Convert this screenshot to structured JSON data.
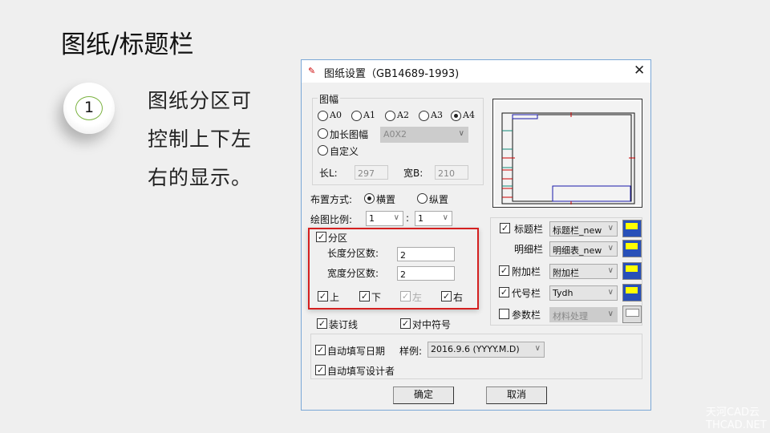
{
  "slide": {
    "title": "图纸/标题栏",
    "step": "1",
    "description": [
      "图纸分区可",
      "控制上下左",
      "右的显示。"
    ]
  },
  "dialog": {
    "title": "图纸设置（GB14689-1993)",
    "paper_group": "图幅",
    "sizes": [
      {
        "label": "A0",
        "selected": false
      },
      {
        "label": "A1",
        "selected": false
      },
      {
        "label": "A2",
        "selected": false
      },
      {
        "label": "A3",
        "selected": false
      },
      {
        "label": "A4",
        "selected": true
      }
    ],
    "extended_label": "加长图幅",
    "extended_value": "A0X2",
    "custom_label": "自定义",
    "length_label": "长L:",
    "length_value": "297",
    "width_label": "宽B:",
    "width_value": "210",
    "layout_label": "布置方式:",
    "layout_options": [
      "横置",
      "纵置"
    ],
    "layout_selected": "横置",
    "scale_label": "绘图比例:",
    "scale_left": "1",
    "scale_sep": ":",
    "scale_right": "1",
    "zone_label": "分区",
    "zone_checked": true,
    "zone_length_label": "长度分区数:",
    "zone_length_value": "2",
    "zone_width_label": "宽度分区数:",
    "zone_width_value": "2",
    "sides": [
      {
        "label": "上",
        "checked": true,
        "disabled": false
      },
      {
        "label": "下",
        "checked": true,
        "disabled": false
      },
      {
        "label": "左",
        "checked": true,
        "disabled": true
      },
      {
        "label": "右",
        "checked": true,
        "disabled": false
      }
    ],
    "binding_label": "装订线",
    "center_mark_label": "对中符号",
    "blocks": [
      {
        "label": "标题栏",
        "checkbox": true,
        "checked": true,
        "value": "标题栏_new",
        "disabled": false
      },
      {
        "label": "明细栏",
        "checkbox": false,
        "checked": false,
        "value": "明细表_new",
        "disabled": false
      },
      {
        "label": "附加栏",
        "checkbox": true,
        "checked": true,
        "value": "附加栏",
        "disabled": false
      },
      {
        "label": "代号栏",
        "checkbox": true,
        "checked": true,
        "value": "Tydh",
        "disabled": false
      },
      {
        "label": "参数栏",
        "checkbox": true,
        "checked": false,
        "value": "材料处理",
        "disabled": true
      }
    ],
    "auto_date_label": "自动填写日期",
    "sample_label": "样例:",
    "date_format": "2016.9.6 (YYYY.M.D)",
    "auto_designer_label": "自动填写设计者",
    "ok": "确定",
    "cancel": "取消"
  },
  "watermark": [
    "天河CAD云",
    "THCAD.NET"
  ]
}
